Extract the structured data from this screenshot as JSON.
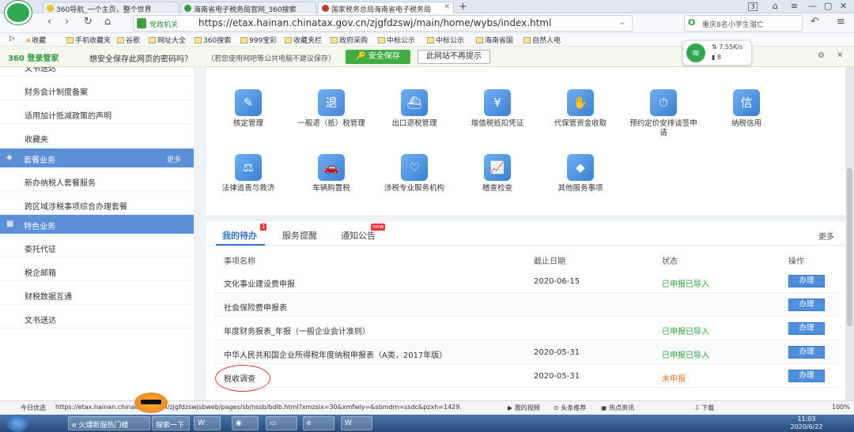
{
  "browser": {
    "tabs": [
      {
        "title": "360导航_一个主页，整个世界",
        "icon_color": "#3a9e3a"
      },
      {
        "title": "海南省电子税务局官网_360搜索",
        "icon_color": "#2ea043"
      },
      {
        "title": "国家税务总局海南省电子税务局",
        "icon_color": "#c0392b"
      }
    ],
    "new_tab": "+",
    "counter": "3",
    "address_label": "党政机关",
    "url": "https://etax.hainan.chinatax.gov.cn/zjgfdzswj/main/home/wybs/index.html",
    "search_text": "重庆8名小学生溺亡",
    "favorites": [
      "收藏",
      "手机收藏夹",
      "谷歌",
      "网址大全",
      "360搜索",
      "999宝彩",
      "收藏夹栏",
      "政府采购",
      "中标公示",
      "中标公示",
      "海南省国",
      "自然人电"
    ]
  },
  "password_bar": {
    "logo": "360 登录管家",
    "question": "想安全保存此网页的密码吗？",
    "hint": "（若您使用网吧等公共电脑不建议保存）",
    "save": "安全保存",
    "never": "此网站不再提示"
  },
  "speed": {
    "rate": "7.55K/s",
    "num": "8"
  },
  "sidebar": {
    "top_cut": "文书送达",
    "group1": [
      "财务会计制度备案",
      "适用加计抵减政策的声明",
      "收藏夹"
    ],
    "header_package": "套餐业务",
    "more": "更多",
    "group2": [
      "新办纳税人套餐服务",
      "跨区域涉税事项综合办理套餐"
    ],
    "header_special": "特色业务",
    "group3": [
      "委托代征",
      "税企邮箱",
      "财税数据互通",
      "文书送达"
    ]
  },
  "services": [
    {
      "label": "核定管理",
      "color": "#3b7fd4"
    },
    {
      "label": "一般退（抵）税管理",
      "color": "#4a86d8"
    },
    {
      "label": "出口退税管理",
      "color": "#3b7fd4"
    },
    {
      "label": "增值税抵扣凭证",
      "color": "#3b7fd4"
    },
    {
      "label": "代保管资金收取",
      "color": "#3b7fd4"
    },
    {
      "label": "预约定价安排谈签申请",
      "color": "#3b7fd4"
    },
    {
      "label": "纳税信用",
      "color": "#3b7fd4"
    },
    {
      "label": "法律追责与救济",
      "color": "#3b7fd4"
    },
    {
      "label": "车辆购置税",
      "color": "#3b7fd4"
    },
    {
      "label": "涉税专业服务机构",
      "color": "#3b7fd4"
    },
    {
      "label": "稽查检查",
      "color": "#3b7fd4"
    },
    {
      "label": "其他服务事项",
      "color": "#3b7fd4"
    }
  ],
  "todo": {
    "tabs": [
      "我的待办",
      "服务提醒",
      "通知公告"
    ],
    "badge": "1",
    "new_badge": "new",
    "more": "更多",
    "headers": [
      "事项名称",
      "截止日期",
      "状态",
      "操作"
    ],
    "rows": [
      {
        "name": "文化事业建设费申报",
        "date": "2020-06-15",
        "status": "已申报已导入",
        "ok": true,
        "action": "办理"
      },
      {
        "name": "社会保险费申报表",
        "date": "",
        "status": "",
        "ok": true,
        "action": "办理"
      },
      {
        "name": "年度财务报表_年报（一般企业会计准则）",
        "date": "",
        "status": "已申报已导入",
        "ok": true,
        "action": "办理"
      },
      {
        "name": "中华人民共和国企业所得税年度纳税申报表（A类，2017年版）",
        "date": "2020-05-31",
        "status": "已申报已导入",
        "ok": true,
        "action": "办理"
      },
      {
        "name": "税收调查",
        "date": "2020-05-31",
        "status": "未申报",
        "ok": false,
        "action": "办理"
      }
    ]
  },
  "statusbar": {
    "left": "今日优选",
    "url": "https://etax.hainan.chinatax.gov.cn/zjgfdzswjsbweb/pages/sb/nssb/bdlb.html?xmzslx=30&xmfwly=&sbmdm=ssdc&pzxh=1429.",
    "items": [
      "我的视频",
      "头条推荐",
      "热点资讯",
      "下载"
    ],
    "zoom": "100%"
  },
  "taskbar": {
    "items": [
      "火爆新服热门楼",
      "搜索一下"
    ],
    "time": "11:03",
    "date": "2020/6/22"
  }
}
